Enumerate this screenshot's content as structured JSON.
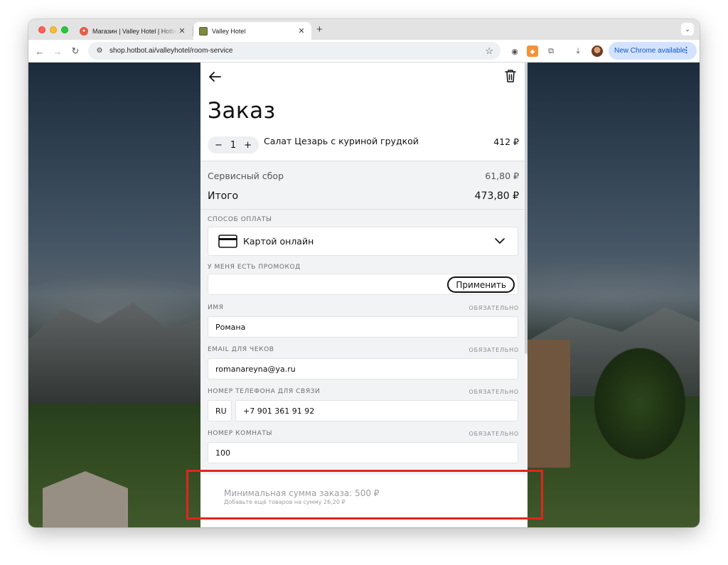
{
  "browser": {
    "tabs": [
      {
        "title": "Магазин | Valley Hotel | Hotbot",
        "active": false
      },
      {
        "title": "Valley Hotel",
        "active": true
      }
    ],
    "new_tab_label": "+",
    "url": "shop.hotbot.ai/valleyhotel/room-service",
    "update_button": "New Chrome available"
  },
  "order": {
    "title": "Заказ",
    "item": {
      "quantity": "1",
      "minus": "−",
      "plus": "+",
      "name": "Салат Цезарь с куриной грудкой",
      "price": "412 ₽"
    },
    "service_fee_label": "Сервисный сбор",
    "service_fee_value": "61,80 ₽",
    "total_label": "Итого",
    "total_value": "473,80 ₽"
  },
  "form": {
    "payment_label": "СПОСОБ ОПЛАТЫ",
    "payment_value": "Картой онлайн",
    "promo_label": "У МЕНЯ ЕСТЬ ПРОМОКОД",
    "promo_value": "",
    "apply_label": "Применить",
    "required_text": "ОБЯЗАТЕЛЬНО",
    "name_label": "ИМЯ",
    "name_value": "Романа",
    "email_label": "EMAIL ДЛЯ ЧЕКОВ",
    "email_value": "romanareyna@ya.ru",
    "phone_label": "НОМЕР ТЕЛЕФОНА ДЛЯ СВЯЗИ",
    "country_code": "RU",
    "phone_value": "+7 901 361 91 92",
    "room_label": "НОМЕР КОМНАТЫ",
    "room_value": "100"
  },
  "footer": {
    "min_sum": "Минимальная сумма заказа: 500 ₽",
    "add_more": "Добавьте ещё товаров на сумму 26,20 ₽"
  },
  "colors": {
    "highlight": "#e1261c",
    "chrome_pill": "#d3e3fd",
    "panel_bg": "#f2f3f5"
  }
}
